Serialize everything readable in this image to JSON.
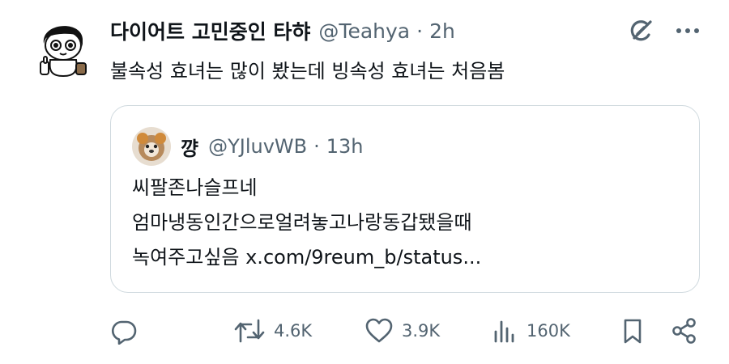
{
  "tweet": {
    "display_name": "다이어트 고민중인 타햐",
    "handle": "@Teahya",
    "separator": "·",
    "time": "2h",
    "text": "불속성 효녀는 많이 봤는데 빙속성 효녀는 처음봄"
  },
  "quoted": {
    "display_name": "꺙",
    "handle": "@YJluvWB",
    "separator": "·",
    "time": "13h",
    "lines": [
      "씨팔존나슬프네",
      "엄마냉동인간으로얼려놓고나랑동갑됐을때",
      "녹여주고싶음 x.com/9reum_b/status..."
    ]
  },
  "actions": {
    "reply": {
      "icon": "reply-icon"
    },
    "retweet": {
      "icon": "retweet-icon",
      "count": "4.6K"
    },
    "like": {
      "icon": "heart-icon",
      "count": "3.9K"
    },
    "views": {
      "icon": "views-icon",
      "count": "160K"
    },
    "bookmark": {
      "icon": "bookmark-icon"
    },
    "share": {
      "icon": "share-icon"
    }
  },
  "top_icons": [
    "grok-icon",
    "more-icon"
  ],
  "colors": {
    "text": "#0f1419",
    "muted": "#536471",
    "border": "#cfd9de"
  }
}
